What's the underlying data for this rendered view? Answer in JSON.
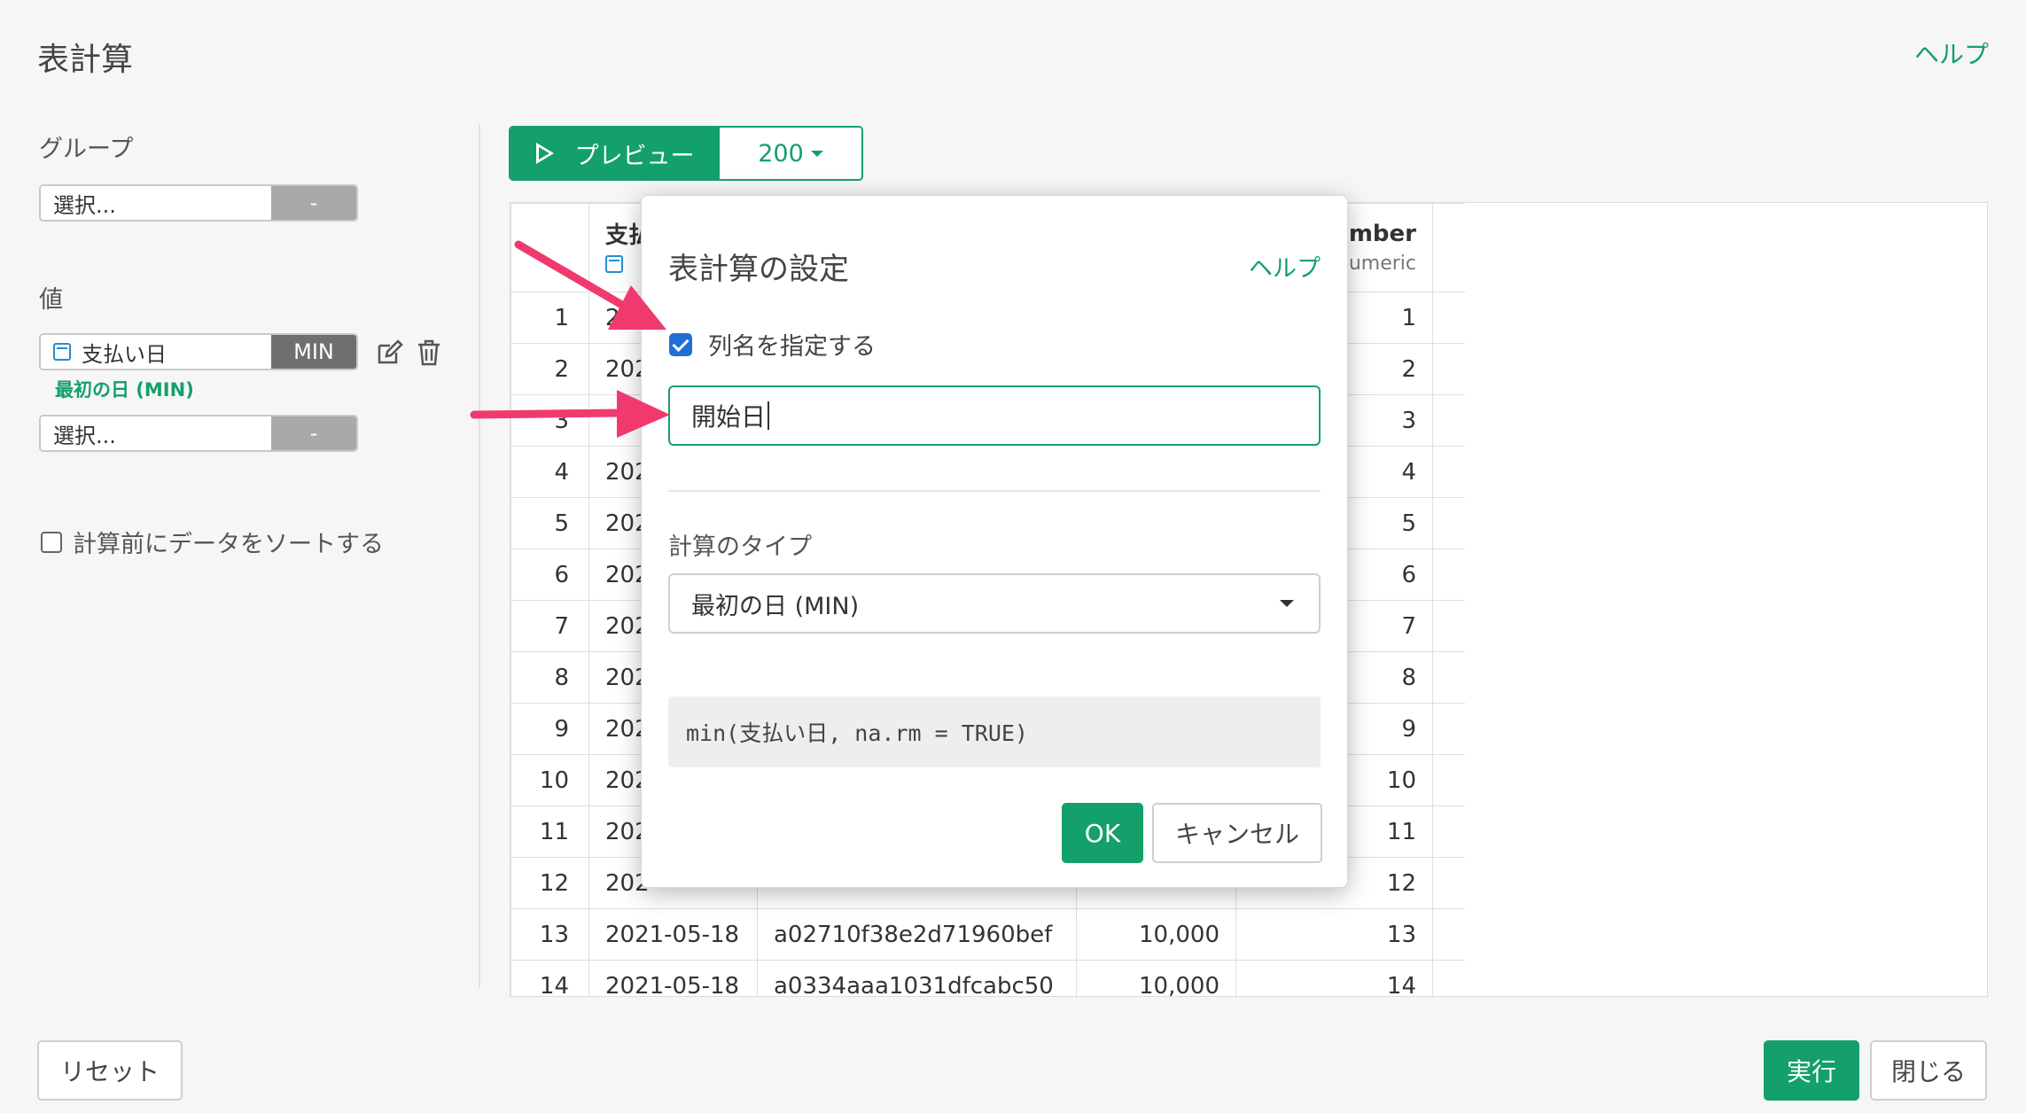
{
  "header": {
    "title": "表計算",
    "help": "ヘルプ"
  },
  "sidebar": {
    "group_label": "グループ",
    "group_select": {
      "placeholder": "選択...",
      "button": "-"
    },
    "value_label": "値",
    "value_item": {
      "column": "支払い日",
      "function": "MIN",
      "sublabel": "最初の日 (MIN)"
    },
    "value_select": {
      "placeholder": "選択...",
      "button": "-"
    },
    "sort_label": "計算前にデータをソートする"
  },
  "toolbar": {
    "preview_label": "プレビュー",
    "count": "200"
  },
  "grid": {
    "headers": [
      {
        "title": "支払",
        "type": ""
      },
      {
        "title": "",
        "type": ""
      },
      {
        "title": "",
        "type": ""
      },
      {
        "title": "umber",
        "type": "umeric"
      }
    ],
    "rows": [
      [
        "1",
        "2",
        "",
        "",
        "1"
      ],
      [
        "2",
        "202",
        "",
        "",
        "2"
      ],
      [
        "3",
        "",
        "",
        "",
        "3"
      ],
      [
        "4",
        "202",
        "",
        "",
        "4"
      ],
      [
        "5",
        "202",
        "",
        "",
        "5"
      ],
      [
        "6",
        "202",
        "",
        "",
        "6"
      ],
      [
        "7",
        "202",
        "",
        "",
        "7"
      ],
      [
        "8",
        "202",
        "",
        "",
        "8"
      ],
      [
        "9",
        "202",
        "",
        "",
        "9"
      ],
      [
        "10",
        "202",
        "",
        "",
        "10"
      ],
      [
        "11",
        "202",
        "",
        "",
        "11"
      ],
      [
        "12",
        "202",
        "",
        "",
        "12"
      ],
      [
        "13",
        "2021-05-18",
        "a02710f38e2d71960bef",
        "10,000",
        "13"
      ],
      [
        "14",
        "2021-05-18",
        "a0334aaa1031dfcabc50",
        "10,000",
        "14"
      ]
    ]
  },
  "modal": {
    "title": "表計算の設定",
    "help": "ヘルプ",
    "specify_name_label": "列名を指定する",
    "name_value": "開始日",
    "type_label": "計算のタイプ",
    "type_value": "最初の日 (MIN)",
    "code": "min(支払い日, na.rm = TRUE)",
    "ok": "OK",
    "cancel": "キャンセル"
  },
  "footer": {
    "reset": "リセット",
    "run": "実行",
    "close": "閉じる"
  },
  "colors": {
    "accent": "#14a06b",
    "checkbox": "#1f6fd6",
    "arrow": "#f03a6e"
  }
}
